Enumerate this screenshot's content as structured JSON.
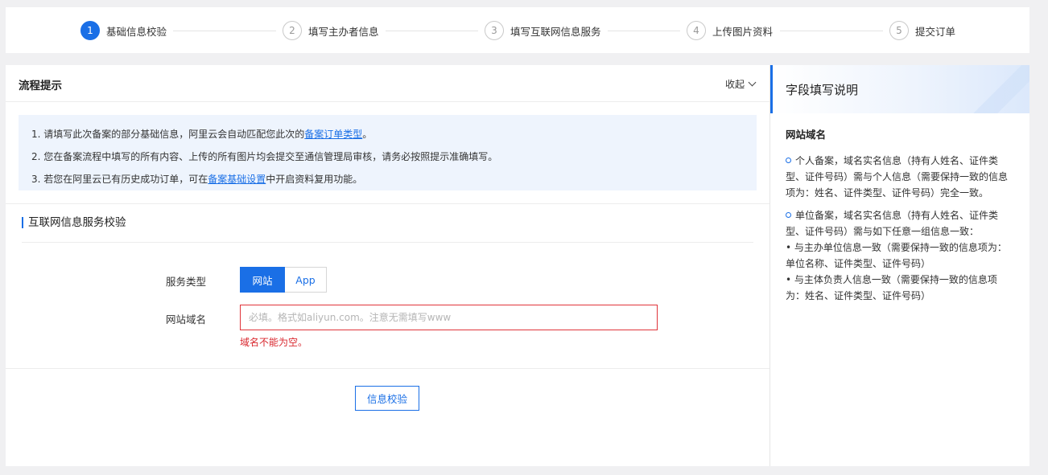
{
  "stepper": {
    "steps": [
      {
        "num": "1",
        "label": "基础信息校验"
      },
      {
        "num": "2",
        "label": "填写主办者信息"
      },
      {
        "num": "3",
        "label": "填写互联网信息服务"
      },
      {
        "num": "4",
        "label": "上传图片资料"
      },
      {
        "num": "5",
        "label": "提交订单"
      }
    ]
  },
  "flow": {
    "title": "流程提示",
    "collapse_label": "收起",
    "notice": {
      "line1_pre": "1. 请填写此次备案的部分基础信息，阿里云会自动匹配您此次的",
      "line1_link": "备案订单类型",
      "line1_post": "。",
      "line2": "2. 您在备案流程中填写的所有内容、上传的所有图片均会提交至通信管理局审核，请务必按照提示准确填写。",
      "line3_pre": "3. 若您在阿里云已有历史成功订单，可在",
      "line3_link": "备案基础设置",
      "line3_post": "中开启资料复用功能。"
    }
  },
  "section": {
    "title": "互联网信息服务校验",
    "service_type_label": "服务类型",
    "service_types": [
      "网站",
      "App"
    ],
    "domain_label": "网站域名",
    "domain_value": "",
    "domain_placeholder": "必填。格式如aliyun.com。注意无需填写www",
    "domain_error": "域名不能为空。",
    "verify_button": "信息校验"
  },
  "side": {
    "title": "字段填写说明",
    "subtitle": "网站域名",
    "para1": "个人备案，域名实名信息（持有人姓名、证件类型、证件号码）需与个人信息（需要保持一致的信息项为：姓名、证件类型、证件号码）完全一致。",
    "para2": "单位备案，域名实名信息（持有人姓名、证件类型、证件号码）需与如下任意一组信息一致：",
    "bullet1": "• 与主办单位信息一致（需要保持一致的信息项为：单位名称、证件类型、证件号码）",
    "bullet2": "• 与主体负责人信息一致（需要保持一致的信息项为：姓名、证件类型、证件号码）"
  },
  "colors": {
    "accent": "#1a6fe6",
    "error": "#d9282f",
    "notice_bg": "#eef4fd"
  }
}
